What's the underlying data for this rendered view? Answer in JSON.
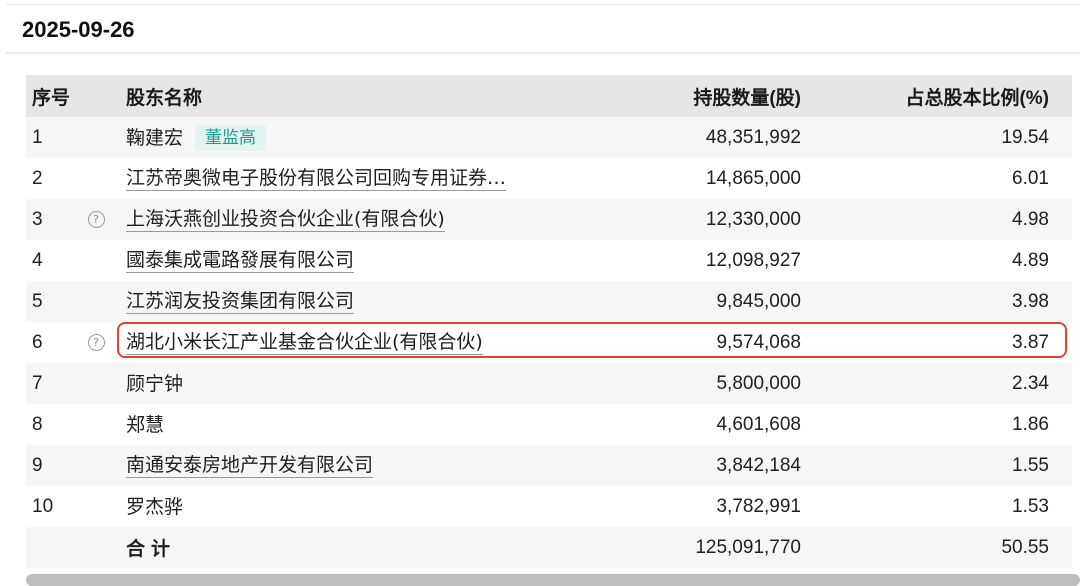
{
  "date": "2025-09-26",
  "table": {
    "headers": {
      "idx": "序号",
      "name": "股东名称",
      "shares": "持股数量(股)",
      "ratio": "占总股本比例(%)"
    },
    "rows": [
      {
        "idx": "1",
        "name": "鞠建宏",
        "tag": "董监高",
        "shares": "48,351,992",
        "ratio": "19.54"
      },
      {
        "idx": "2",
        "name": "江苏帝奥微电子股份有限公司回购专用证券…",
        "shares": "14,865,000",
        "ratio": "6.01"
      },
      {
        "idx": "3",
        "name": "上海沃燕创业投资合伙企业(有限合伙)",
        "shares": "12,330,000",
        "ratio": "4.98"
      },
      {
        "idx": "4",
        "name": "國泰集成電路發展有限公司",
        "shares": "12,098,927",
        "ratio": "4.89"
      },
      {
        "idx": "5",
        "name": "江苏润友投资集团有限公司",
        "shares": "9,845,000",
        "ratio": "3.98"
      },
      {
        "idx": "6",
        "name": "湖北小米长江产业基金合伙企业(有限合伙)",
        "shares": "9,574,068",
        "ratio": "3.87"
      },
      {
        "idx": "7",
        "name": "顾宁钟",
        "shares": "5,800,000",
        "ratio": "2.34"
      },
      {
        "idx": "8",
        "name": "郑慧",
        "shares": "4,601,608",
        "ratio": "1.86"
      },
      {
        "idx": "9",
        "name": "南通安泰房地产开发有限公司",
        "shares": "3,842,184",
        "ratio": "1.55"
      },
      {
        "idx": "10",
        "name": "罗杰骅",
        "shares": "3,782,991",
        "ratio": "1.53"
      }
    ],
    "total": {
      "label": "合计",
      "shares": "125,091,770",
      "ratio": "50.55"
    }
  },
  "icons": {
    "help": "question-circle-icon"
  },
  "colors": {
    "highlight": "#e0432f",
    "tag_bg": "#e3f3f1",
    "tag_text": "#1f9c8c",
    "header_bg": "#e6e6e6",
    "alt_row_bg": "#f6f6f6"
  }
}
